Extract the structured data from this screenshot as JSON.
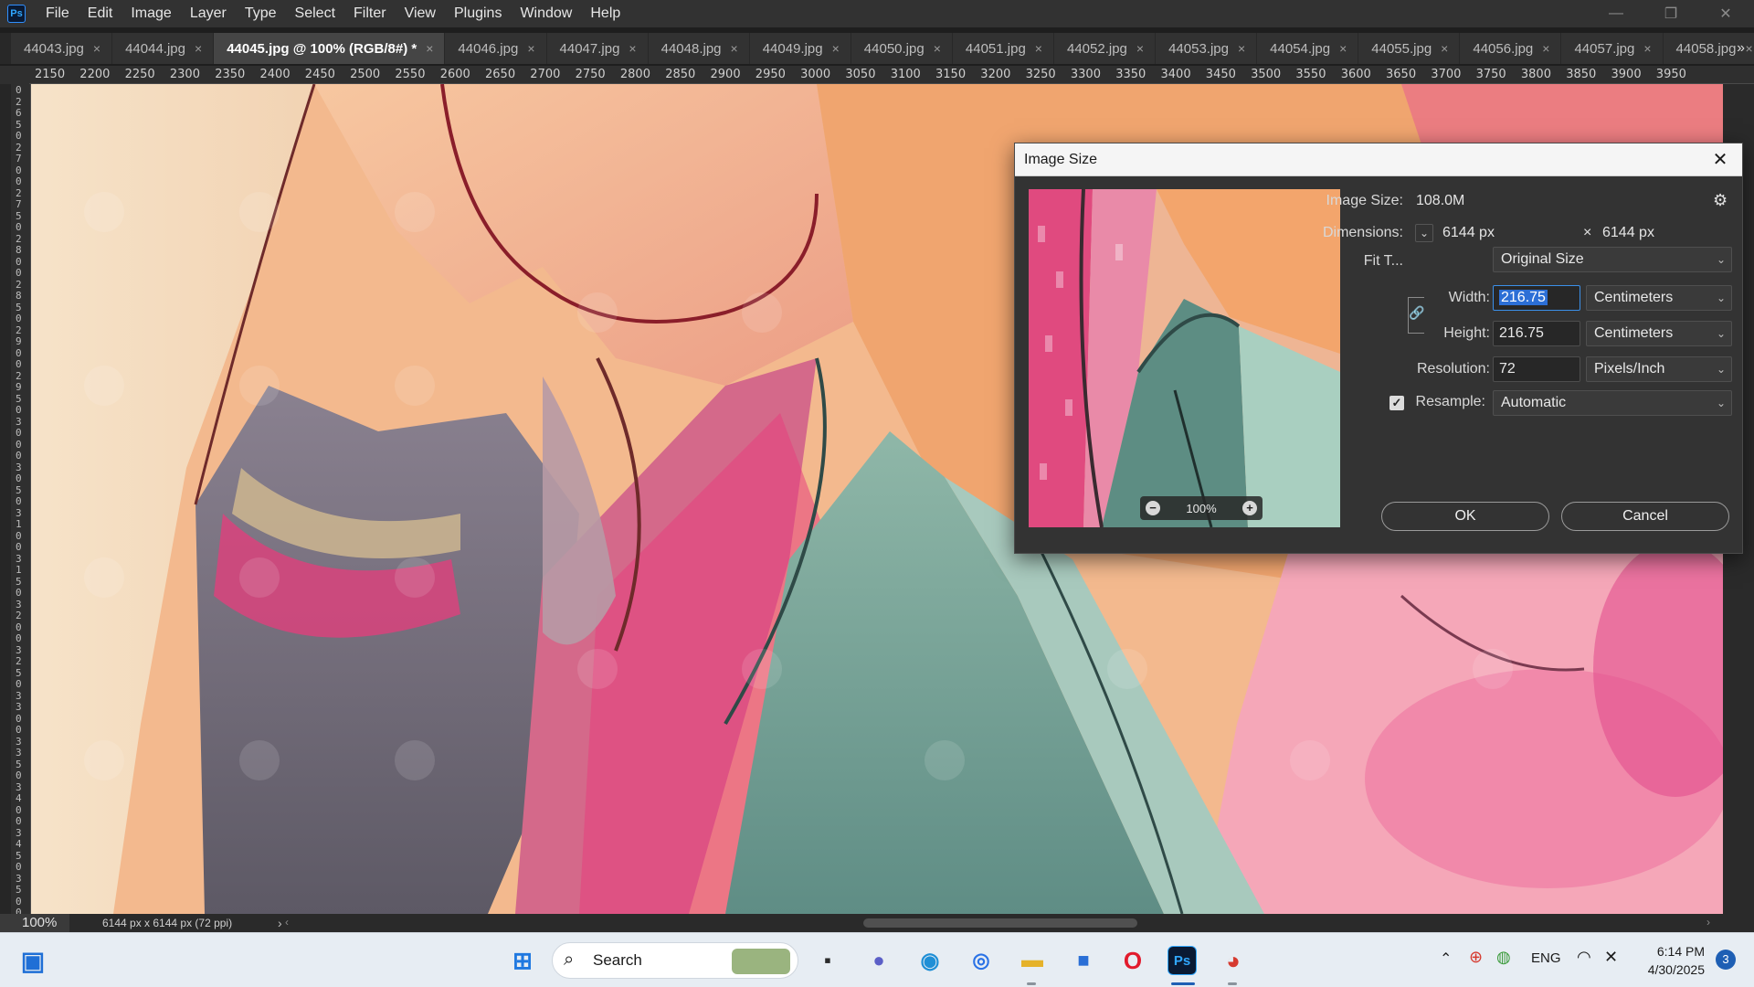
{
  "app": {
    "logo": "Ps",
    "menu": [
      "File",
      "Edit",
      "Image",
      "Layer",
      "Type",
      "Select",
      "Filter",
      "View",
      "Plugins",
      "Window",
      "Help"
    ],
    "window_controls": {
      "minimize": "—",
      "restore": "❐",
      "close": "✕"
    }
  },
  "tabs": [
    {
      "label": "44043.jpg",
      "active": false
    },
    {
      "label": "44044.jpg",
      "active": false
    },
    {
      "label": "44045.jpg @ 100% (RGB/8#) *",
      "active": true
    },
    {
      "label": "44046.jpg",
      "active": false
    },
    {
      "label": "44047.jpg",
      "active": false
    },
    {
      "label": "44048.jpg",
      "active": false
    },
    {
      "label": "44049.jpg",
      "active": false
    },
    {
      "label": "44050.jpg",
      "active": false
    },
    {
      "label": "44051.jpg",
      "active": false
    },
    {
      "label": "44052.jpg",
      "active": false
    },
    {
      "label": "44053.jpg",
      "active": false
    },
    {
      "label": "44054.jpg",
      "active": false
    },
    {
      "label": "44055.jpg",
      "active": false
    },
    {
      "label": "44056.jpg",
      "active": false
    },
    {
      "label": "44057.jpg",
      "active": false
    },
    {
      "label": "44058.jpg",
      "active": false
    }
  ],
  "tab_overflow": "»",
  "ruler_top": [
    "2150",
    "2200",
    "2250",
    "2300",
    "2350",
    "2400",
    "2450",
    "2500",
    "2550",
    "2600",
    "2650",
    "2700",
    "2750",
    "2800",
    "2850",
    "2900",
    "2950",
    "3000",
    "3050",
    "3100",
    "3150",
    "3200",
    "3250",
    "3300",
    "3350",
    "3400",
    "3450",
    "3500",
    "3550",
    "3600",
    "3650",
    "3700",
    "3750",
    "3800",
    "3850",
    "3900",
    "3950"
  ],
  "ruler_left_digits": [
    "0",
    "2",
    "6",
    "5",
    "0",
    "2",
    "7",
    "0",
    "0",
    "2",
    "7",
    "5",
    "0",
    "2",
    "8",
    "0",
    "0",
    "2",
    "8",
    "5",
    "0",
    "2",
    "9",
    "0",
    "0",
    "2",
    "9",
    "5",
    "0",
    "3",
    "0",
    "0",
    "0",
    "3",
    "0",
    "5",
    "0",
    "3",
    "1",
    "0",
    "0",
    "3",
    "1",
    "5",
    "0",
    "3",
    "2",
    "0",
    "0",
    "3",
    "2",
    "5",
    "0",
    "3",
    "3",
    "0",
    "0",
    "3",
    "3",
    "5",
    "0",
    "3",
    "4",
    "0",
    "0",
    "3",
    "4",
    "5",
    "0",
    "3",
    "5",
    "0",
    "0"
  ],
  "statusbar": {
    "zoom": "100%",
    "doc_info": "6144 px x 6144 px (72 ppi)",
    "arrow": "›"
  },
  "dialog": {
    "title": "Image Size",
    "close": "✕",
    "image_size_label": "Image Size:",
    "image_size_value": "108.0M",
    "dimensions_label": "Dimensions:",
    "dim_width": "6144 px",
    "dim_x": "×",
    "dim_height": "6144 px",
    "fit_label": "Fit T...",
    "fit_value": "Original Size",
    "width_label": "Width:",
    "width_value": "216.75",
    "width_unit": "Centimeters",
    "height_label": "Height:",
    "height_value": "216.75",
    "height_unit": "Centimeters",
    "resolution_label": "Resolution:",
    "resolution_value": "72",
    "resolution_unit": "Pixels/Inch",
    "resample_label": "Resample:",
    "resample_checked": true,
    "resample_value": "Automatic",
    "preview_zoom": "100%",
    "ok_label": "OK",
    "cancel_label": "Cancel"
  },
  "taskbar": {
    "search_placeholder": "Search",
    "tray": {
      "lang": "ENG",
      "time": "6:14 PM",
      "date": "4/30/2025",
      "notifications": "3"
    },
    "pinned": [
      "start-icon",
      "search",
      "widgets-icon",
      "task-view-icon",
      "teams-icon",
      "edge-icon",
      "snipping-tool-icon",
      "file-explorer-icon",
      "store-icon",
      "opera-icon",
      "photoshop-icon",
      "chrome-icon"
    ]
  }
}
